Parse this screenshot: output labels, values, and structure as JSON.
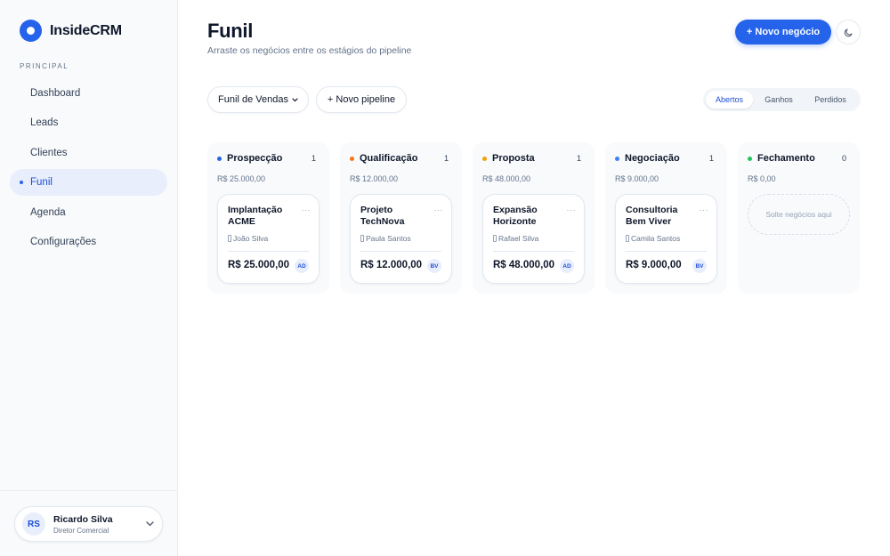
{
  "sidebar": {
    "brand": "InsideCRM",
    "section_label": "PRINCIPAL",
    "items": [
      {
        "label": "Dashboard",
        "active": false
      },
      {
        "label": "Leads",
        "active": false
      },
      {
        "label": "Clientes",
        "active": false
      },
      {
        "label": "Funil",
        "active": true
      },
      {
        "label": "Agenda",
        "active": false
      },
      {
        "label": "Configurações",
        "active": false
      }
    ],
    "user": {
      "initials": "RS",
      "name": "Ricardo Silva",
      "role": "Diretor Comercial"
    }
  },
  "header": {
    "title": "Funil",
    "subtitle": "Arraste os negócios entre os estágios do pipeline",
    "new_deal_label": "+ Novo negócio"
  },
  "toolbar": {
    "pipeline_select": "Funil de Vendas",
    "new_pipeline_label": "+ Novo pipeline",
    "filters": [
      {
        "label": "Abertos",
        "active": true
      },
      {
        "label": "Ganhos",
        "active": false
      },
      {
        "label": "Perdidos",
        "active": false
      }
    ]
  },
  "board": {
    "columns": [
      {
        "name": "Prospecção",
        "count": "1",
        "total": "R$ 25.000,00",
        "dot_color": "#2563eb",
        "cards": [
          {
            "title": "Implantação ACME",
            "owner": "João Silva",
            "amount": "R$ 25.000,00",
            "badge": "AD"
          }
        ]
      },
      {
        "name": "Qualificação",
        "count": "1",
        "total": "R$ 12.000,00",
        "dot_color": "#f97316",
        "cards": [
          {
            "title": "Projeto TechNova",
            "owner": "Paula Santos",
            "amount": "R$ 12.000,00",
            "badge": "BV"
          }
        ]
      },
      {
        "name": "Proposta",
        "count": "1",
        "total": "R$ 48.000,00",
        "dot_color": "#f59e0b",
        "cards": [
          {
            "title": "Expansão Horizonte",
            "owner": "Rafael Silva",
            "amount": "R$ 48.000,00",
            "badge": "AD"
          }
        ]
      },
      {
        "name": "Negociação",
        "count": "1",
        "total": "R$ 9.000,00",
        "dot_color": "#3b82f6",
        "cards": [
          {
            "title": "Consultoria Bem Viver",
            "owner": "Camila Santos",
            "amount": "R$ 9.000,00",
            "badge": "BV"
          }
        ]
      },
      {
        "name": "Fechamento",
        "count": "0",
        "total": "R$ 0,00",
        "dot_color": "#22c55e",
        "cards": [],
        "empty_label": "Solte negócios aqui"
      }
    ]
  }
}
